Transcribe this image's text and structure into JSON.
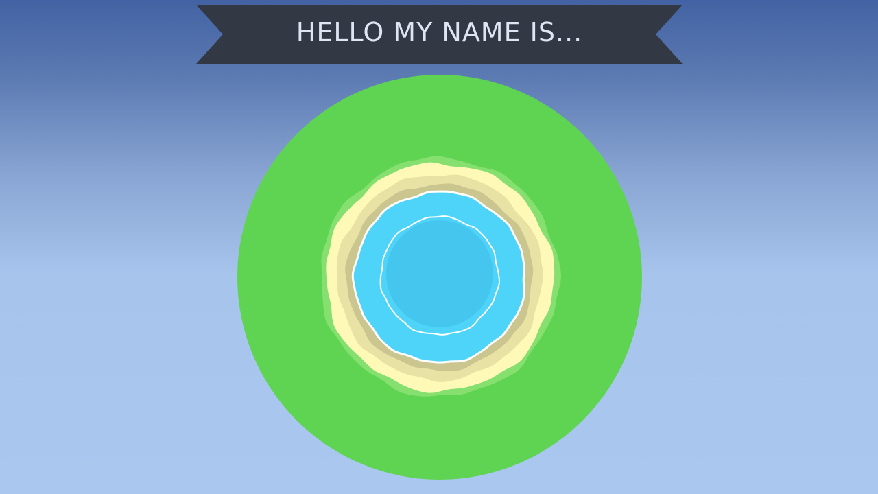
{
  "banner": {
    "title": "HELLO MY NAME IS..."
  },
  "colors": {
    "sky_top": "#4262a3",
    "sky_bottom": "#aac8ef",
    "banner_fill": "#333845",
    "banner_text": "#dfe6f3",
    "grass": "#5fd352",
    "grass_edge": "#86e070",
    "sand_light": "#fff9b8",
    "sand_mid": "#e8e2a4",
    "sand_dark": "#cbc590",
    "shore_foam": "#ffffff",
    "water_light": "#4fd4f9",
    "water_deep": "#45c6ef"
  }
}
